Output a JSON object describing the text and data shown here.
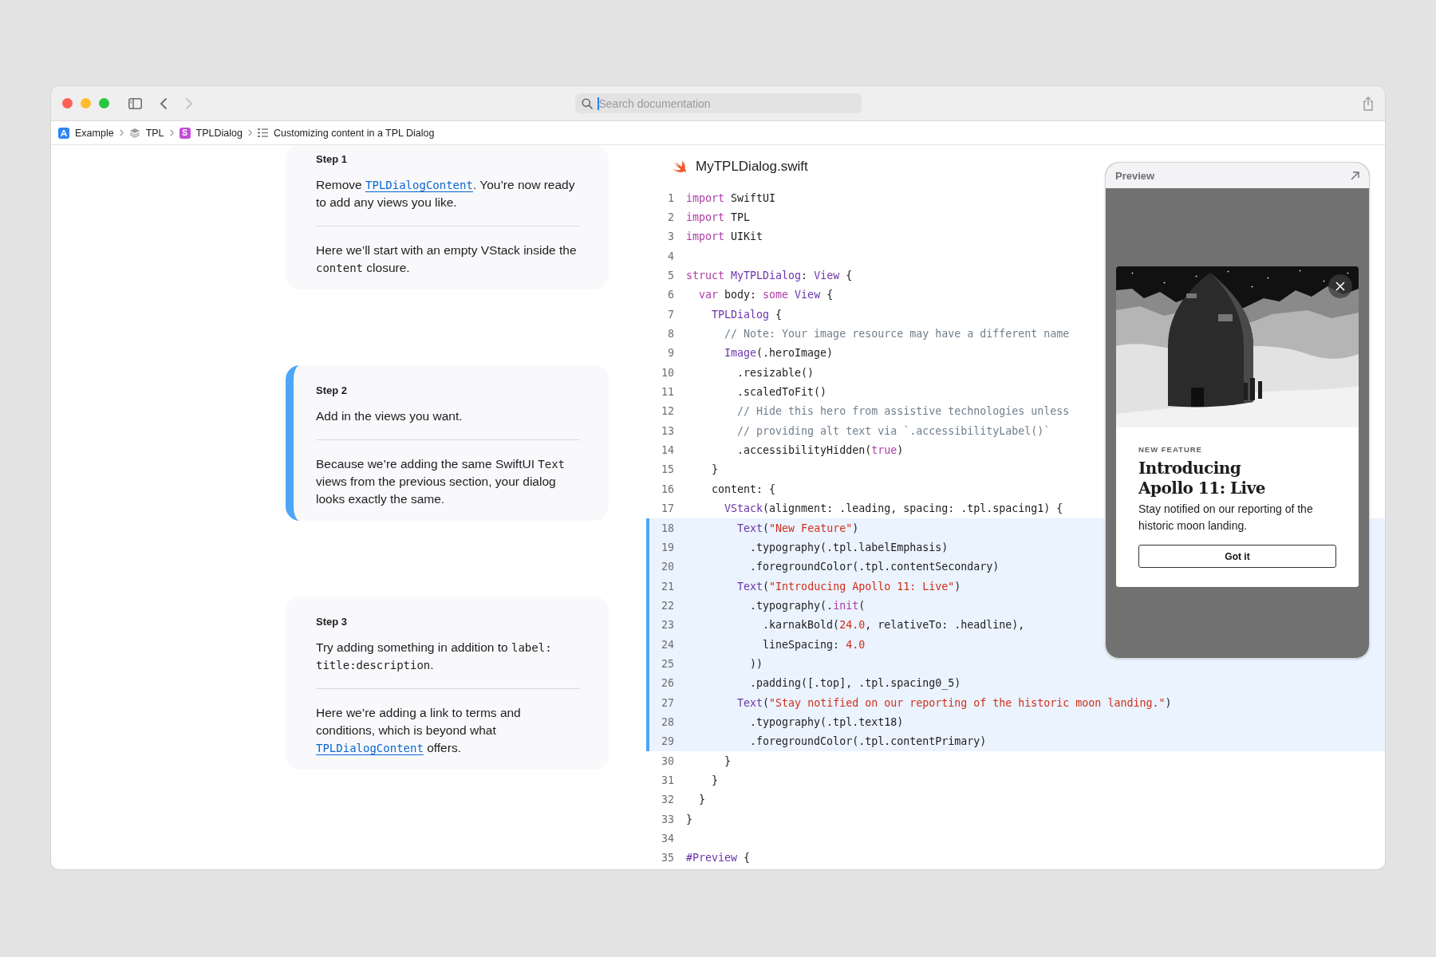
{
  "toolbar": {
    "back_enabled": true,
    "forward_enabled": false,
    "search": {
      "placeholder": "Search documentation",
      "focused": true
    }
  },
  "breadcrumbs": [
    {
      "kind": "app",
      "label": "Example"
    },
    {
      "kind": "framework",
      "label": "TPL"
    },
    {
      "kind": "symbol",
      "symbol": "S",
      "label": "TPLDialog"
    },
    {
      "kind": "article",
      "label": "Customizing content in a TPL Dialog"
    }
  ],
  "steps": [
    {
      "label": "Step 1",
      "selected": false,
      "paragraphs": [
        [
          {
            "kind": "text",
            "text": "Remove "
          },
          {
            "kind": "link",
            "text": "TPLDialogContent"
          },
          {
            "kind": "text",
            "text": ". You’re now ready to add any views you like."
          }
        ],
        [
          {
            "kind": "text",
            "text": "Here we’ll start with an empty VStack inside the "
          },
          {
            "kind": "code",
            "text": "content"
          },
          {
            "kind": "text",
            "text": " closure."
          }
        ]
      ]
    },
    {
      "label": "Step 2",
      "selected": true,
      "paragraphs": [
        [
          {
            "kind": "text",
            "text": "Add in the views you want."
          }
        ],
        [
          {
            "kind": "text",
            "text": "Because we’re adding the same SwiftUI "
          },
          {
            "kind": "code",
            "text": "Text"
          },
          {
            "kind": "text",
            "text": " views from the previous section, your dialog looks exactly the same."
          }
        ]
      ]
    },
    {
      "label": "Step 3",
      "selected": false,
      "paragraphs": [
        [
          {
            "kind": "text",
            "text": "Try adding something in addition to "
          },
          {
            "kind": "code",
            "text": "label: title:description"
          },
          {
            "kind": "text",
            "text": "."
          }
        ],
        [
          {
            "kind": "text",
            "text": "Here we’re adding a link to terms and conditions, which is beyond what "
          },
          {
            "kind": "link",
            "text": "TPLDialogContent"
          },
          {
            "kind": "text",
            "text": " offers."
          }
        ]
      ]
    }
  ],
  "code": {
    "filename": "MyTPLDialog.swift",
    "lines": [
      {
        "number": "1",
        "highlighted": false,
        "tokens": [
          {
            "kind": "keyword",
            "text": "import "
          },
          {
            "kind": "plain",
            "text": "SwiftUI"
          }
        ]
      },
      {
        "number": "2",
        "highlighted": false,
        "tokens": [
          {
            "kind": "keyword",
            "text": "import "
          },
          {
            "kind": "plain",
            "text": "TPL"
          }
        ]
      },
      {
        "number": "3",
        "highlighted": false,
        "tokens": [
          {
            "kind": "keyword",
            "text": "import "
          },
          {
            "kind": "plain",
            "text": "UIKit"
          }
        ]
      },
      {
        "number": "4",
        "highlighted": false
      },
      {
        "number": "5",
        "highlighted": false,
        "tokens": [
          {
            "kind": "keyword",
            "text": "struct "
          },
          {
            "kind": "type",
            "text": "MyTPLDialog"
          },
          {
            "kind": "plain",
            "text": ": "
          },
          {
            "kind": "type",
            "text": "View"
          },
          {
            "kind": "plain",
            "text": " {"
          }
        ]
      },
      {
        "number": "6",
        "highlighted": false,
        "tokens": [
          {
            "kind": "keyword",
            "text": "  var"
          },
          {
            "kind": "plain",
            "text": " body: "
          },
          {
            "kind": "keyword",
            "text": "some "
          },
          {
            "kind": "type",
            "text": "View"
          },
          {
            "kind": "plain",
            "text": " {"
          }
        ]
      },
      {
        "number": "7",
        "highlighted": false,
        "tokens": [
          {
            "kind": "type",
            "text": "    TPLDialog"
          },
          {
            "kind": "plain",
            "text": " {"
          }
        ]
      },
      {
        "number": "8",
        "highlighted": false,
        "tokens": [
          {
            "kind": "comment",
            "text": "      // Note: Your image resource may have a different name"
          }
        ]
      },
      {
        "number": "9",
        "highlighted": false,
        "tokens": [
          {
            "kind": "type",
            "text": "      Image"
          },
          {
            "kind": "plain",
            "text": "(.heroImage)"
          }
        ]
      },
      {
        "number": "10",
        "highlighted": false,
        "tokens": [
          {
            "kind": "plain",
            "text": "        .resizable()"
          }
        ]
      },
      {
        "number": "11",
        "highlighted": false,
        "tokens": [
          {
            "kind": "plain",
            "text": "        .scaledToFit()"
          }
        ]
      },
      {
        "number": "12",
        "highlighted": false,
        "tokens": [
          {
            "kind": "comment",
            "text": "        // Hide this hero from assistive technologies unless"
          }
        ]
      },
      {
        "number": "13",
        "highlighted": false,
        "tokens": [
          {
            "kind": "comment",
            "text": "        // providing alt text via `.accessibilityLabel()`"
          }
        ]
      },
      {
        "number": "14",
        "highlighted": false,
        "tokens": [
          {
            "kind": "plain",
            "text": "        .accessibilityHidden("
          },
          {
            "kind": "keyword",
            "text": "true"
          },
          {
            "kind": "plain",
            "text": ")"
          }
        ]
      },
      {
        "number": "15",
        "highlighted": false,
        "tokens": [
          {
            "kind": "plain",
            "text": "    }"
          }
        ]
      },
      {
        "number": "16",
        "highlighted": false,
        "tokens": [
          {
            "kind": "plain",
            "text": "    content: {"
          }
        ]
      },
      {
        "number": "17",
        "highlighted": false,
        "tokens": [
          {
            "kind": "type",
            "text": "      VStack"
          },
          {
            "kind": "plain",
            "text": "(alignment: .leading, spacing: .tpl.spacing1) {"
          }
        ]
      },
      {
        "number": "18",
        "highlighted": true,
        "tokens": [
          {
            "kind": "type",
            "text": "        Text"
          },
          {
            "kind": "plain",
            "text": "("
          },
          {
            "kind": "string",
            "text": "\"New Feature\""
          },
          {
            "kind": "plain",
            "text": ")"
          }
        ]
      },
      {
        "number": "19",
        "highlighted": true,
        "tokens": [
          {
            "kind": "plain",
            "text": "          .typography(.tpl.labelEmphasis)"
          }
        ]
      },
      {
        "number": "20",
        "highlighted": true,
        "tokens": [
          {
            "kind": "plain",
            "text": "          .foregroundColor(.tpl.contentSecondary)"
          }
        ]
      },
      {
        "number": "21",
        "highlighted": true,
        "tokens": [
          {
            "kind": "type",
            "text": "        Text"
          },
          {
            "kind": "plain",
            "text": "("
          },
          {
            "kind": "string",
            "text": "\"Introducing Apollo 11: Live\""
          },
          {
            "kind": "plain",
            "text": ")"
          }
        ]
      },
      {
        "number": "22",
        "highlighted": true,
        "tokens": [
          {
            "kind": "plain",
            "text": "          .typography(."
          },
          {
            "kind": "keyword",
            "text": "init"
          },
          {
            "kind": "plain",
            "text": "("
          }
        ]
      },
      {
        "number": "23",
        "highlighted": true,
        "tokens": [
          {
            "kind": "plain",
            "text": "            .karnakBold("
          },
          {
            "kind": "number",
            "text": "24.0"
          },
          {
            "kind": "plain",
            "text": ", relativeTo: .headline),"
          }
        ]
      },
      {
        "number": "24",
        "highlighted": true,
        "tokens": [
          {
            "kind": "plain",
            "text": "            lineSpacing: "
          },
          {
            "kind": "number",
            "text": "4.0"
          }
        ]
      },
      {
        "number": "25",
        "highlighted": true,
        "tokens": [
          {
            "kind": "plain",
            "text": "          ))"
          }
        ]
      },
      {
        "number": "26",
        "highlighted": true,
        "tokens": [
          {
            "kind": "plain",
            "text": "          .padding([.top], .tpl.spacing0_5)"
          }
        ]
      },
      {
        "number": "27",
        "highlighted": true,
        "tokens": [
          {
            "kind": "type",
            "text": "        Text"
          },
          {
            "kind": "plain",
            "text": "("
          },
          {
            "kind": "string",
            "text": "\"Stay notified on our reporting of the historic moon landing.\""
          },
          {
            "kind": "plain",
            "text": ")"
          }
        ]
      },
      {
        "number": "28",
        "highlighted": true,
        "tokens": [
          {
            "kind": "plain",
            "text": "          .typography(.tpl.text18)"
          }
        ]
      },
      {
        "number": "29",
        "highlighted": true,
        "tokens": [
          {
            "kind": "plain",
            "text": "          .foregroundColor(.tpl.contentPrimary)"
          }
        ]
      },
      {
        "number": "30",
        "highlighted": false,
        "tokens": [
          {
            "kind": "plain",
            "text": "      }"
          }
        ]
      },
      {
        "number": "31",
        "highlighted": false,
        "tokens": [
          {
            "kind": "plain",
            "text": "    }"
          }
        ]
      },
      {
        "number": "32",
        "highlighted": false,
        "tokens": [
          {
            "kind": "plain",
            "text": "  }"
          }
        ]
      },
      {
        "number": "33",
        "highlighted": false,
        "tokens": [
          {
            "kind": "plain",
            "text": "}"
          }
        ]
      },
      {
        "number": "34",
        "highlighted": false
      },
      {
        "number": "35",
        "highlighted": false,
        "tokens": [
          {
            "kind": "type",
            "text": "#Preview"
          },
          {
            "kind": "plain",
            "text": " {"
          }
        ]
      }
    ]
  },
  "preview": {
    "title": "Preview",
    "dialog": {
      "eyebrow": "NEW FEATURE",
      "title": "Introducing Apollo 11: Live",
      "body": "Stay notified on our reporting of the historic moon landing.",
      "button": "Got it"
    }
  }
}
